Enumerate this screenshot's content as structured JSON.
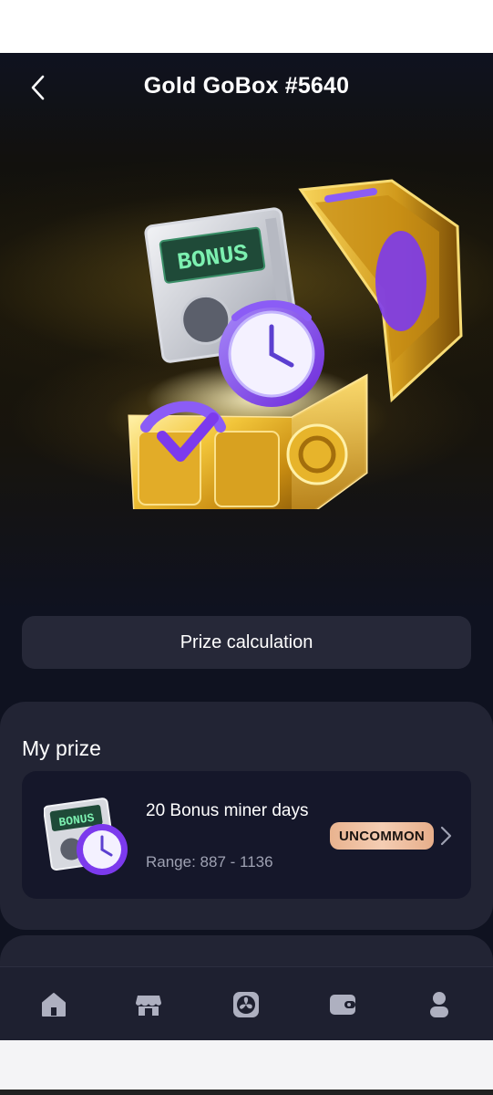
{
  "header": {
    "title": "Gold GoBox #5640",
    "back_icon": "chevron-left-icon"
  },
  "hero": {
    "bonus_text": "BONUS"
  },
  "actions": {
    "prize_calculation_label": "Prize calculation"
  },
  "my_prize": {
    "title": "My prize",
    "item": {
      "name": "20 Bonus miner days",
      "range": "Range: 887 - 1136",
      "badge": "UNCOMMON",
      "badge_color": "#f0c2a2",
      "thumb_text": "BONUS"
    }
  },
  "nav": {
    "items": [
      {
        "icon": "home-icon"
      },
      {
        "icon": "store-icon"
      },
      {
        "icon": "mining-fan-icon"
      },
      {
        "icon": "wallet-icon"
      },
      {
        "icon": "profile-icon"
      }
    ]
  },
  "colors": {
    "background": "#0f1220",
    "card": "#222434",
    "accent_purple": "#8b5cf6",
    "gold": "#e6b422"
  }
}
